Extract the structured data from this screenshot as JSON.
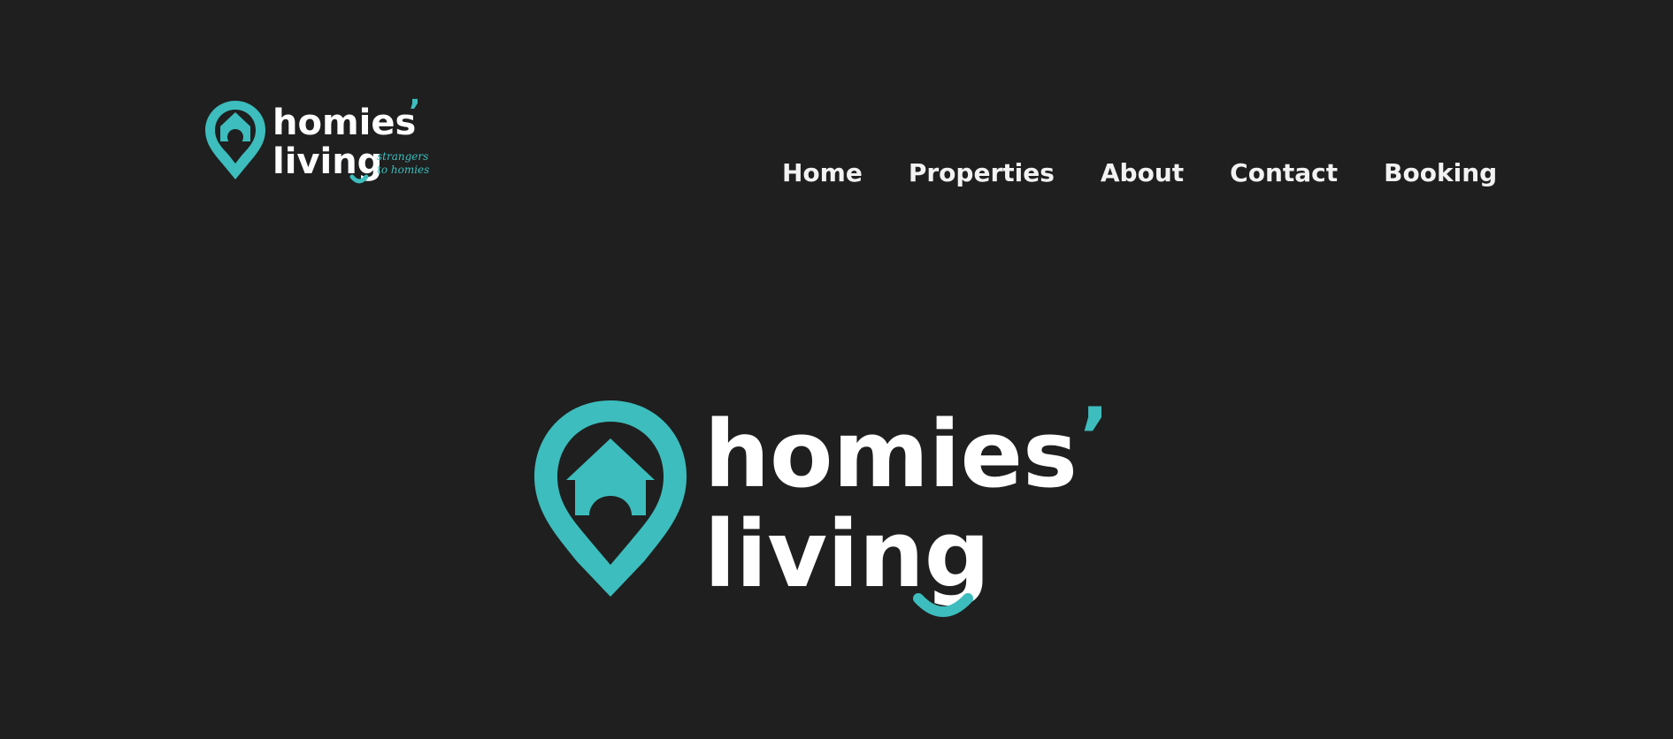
{
  "brand": {
    "name_line1": "homies",
    "name_line2": "living",
    "apostrophe": "’",
    "tagline_line1": "strangers",
    "tagline_line2": "to homies",
    "accent_color": "#3dbdbd",
    "text_color": "#ffffff",
    "background_color": "#1f1f1f"
  },
  "nav": {
    "items": [
      {
        "label": "Home"
      },
      {
        "label": "Properties"
      },
      {
        "label": "About"
      },
      {
        "label": "Contact"
      },
      {
        "label": "Booking"
      }
    ]
  },
  "icons": {
    "logo_mark": "location-pin-house-icon"
  }
}
